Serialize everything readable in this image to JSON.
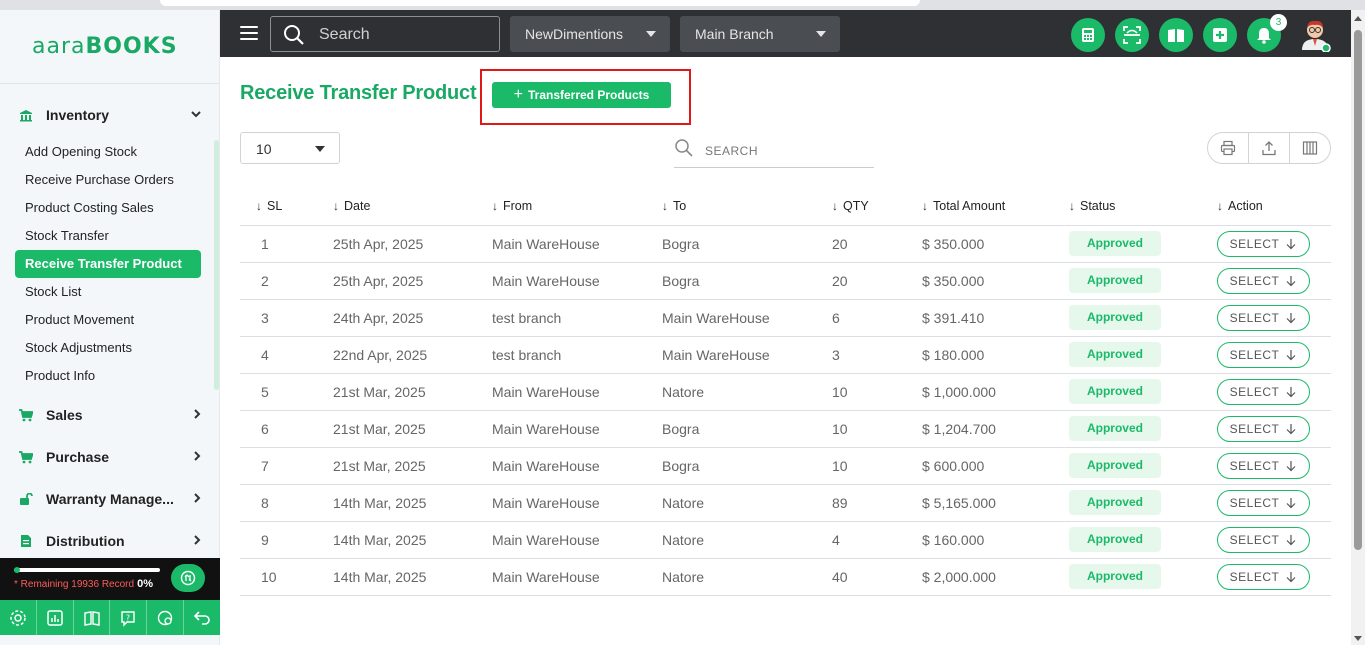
{
  "app": {
    "logo_text_light": "aara",
    "logo_text_bold": "BOOKS",
    "accent_color": "#1aba69"
  },
  "topbar": {
    "search_placeholder": "Search",
    "company_select": "NewDimentions",
    "branch_select": "Main Branch",
    "notification_count": "3",
    "icons": [
      "calculator-icon",
      "scan-icon",
      "book-icon",
      "plus-box-icon",
      "bell-icon"
    ]
  },
  "sidebar": {
    "groups": [
      {
        "label": "Inventory",
        "icon": "warehouse-icon",
        "expanded": true
      },
      {
        "label": "Sales",
        "icon": "cart-icon"
      },
      {
        "label": "Purchase",
        "icon": "cart-icon"
      },
      {
        "label": "Warranty Manage...",
        "icon": "unlock-icon"
      },
      {
        "label": "Distribution",
        "icon": "document-icon"
      }
    ],
    "inventory_items": [
      "Add Opening Stock",
      "Receive Purchase Orders",
      "Product Costing Sales",
      "Stock Transfer",
      "Receive Transfer Product",
      "Stock List",
      "Product Movement",
      "Stock Adjustments",
      "Product Info"
    ],
    "active_item": "Receive Transfer Product",
    "record_text": "* Remaining 19936 Record",
    "record_percent": "0%",
    "bottom_icons": [
      "settings-icon",
      "chart-icon",
      "book-open-icon",
      "help-icon",
      "chat-icon",
      "undo-icon"
    ]
  },
  "main": {
    "title": "Receive Transfer Product",
    "add_button_label": "Transferred Products",
    "page_size": "10",
    "search_placeholder": "SEARCH",
    "table": {
      "headers": [
        "SL",
        "Date",
        "From",
        "To",
        "QTY",
        "Total Amount",
        "Status",
        "Action"
      ],
      "rows": [
        {
          "sl": "1",
          "date": "25th Apr, 2025",
          "from": "Main WareHouse",
          "to": "Bogra",
          "qty": "20",
          "amount": "$ 350.000",
          "status": "Approved",
          "action": "SELECT"
        },
        {
          "sl": "2",
          "date": "25th Apr, 2025",
          "from": "Main WareHouse",
          "to": "Bogra",
          "qty": "20",
          "amount": "$ 350.000",
          "status": "Approved",
          "action": "SELECT"
        },
        {
          "sl": "3",
          "date": "24th Apr, 2025",
          "from": "test branch",
          "to": "Main WareHouse",
          "qty": "6",
          "amount": "$ 391.410",
          "status": "Approved",
          "action": "SELECT"
        },
        {
          "sl": "4",
          "date": "22nd Apr, 2025",
          "from": "test branch",
          "to": "Main WareHouse",
          "qty": "3",
          "amount": "$ 180.000",
          "status": "Approved",
          "action": "SELECT"
        },
        {
          "sl": "5",
          "date": "21st Mar, 2025",
          "from": "Main WareHouse",
          "to": "Natore",
          "qty": "10",
          "amount": "$ 1,000.000",
          "status": "Approved",
          "action": "SELECT"
        },
        {
          "sl": "6",
          "date": "21st Mar, 2025",
          "from": "Main WareHouse",
          "to": "Bogra",
          "qty": "10",
          "amount": "$ 1,204.700",
          "status": "Approved",
          "action": "SELECT"
        },
        {
          "sl": "7",
          "date": "21st Mar, 2025",
          "from": "Main WareHouse",
          "to": "Bogra",
          "qty": "10",
          "amount": "$ 600.000",
          "status": "Approved",
          "action": "SELECT"
        },
        {
          "sl": "8",
          "date": "14th Mar, 2025",
          "from": "Main WareHouse",
          "to": "Natore",
          "qty": "89",
          "amount": "$ 5,165.000",
          "status": "Approved",
          "action": "SELECT"
        },
        {
          "sl": "9",
          "date": "14th Mar, 2025",
          "from": "Main WareHouse",
          "to": "Natore",
          "qty": "4",
          "amount": "$ 160.000",
          "status": "Approved",
          "action": "SELECT"
        },
        {
          "sl": "10",
          "date": "14th Mar, 2025",
          "from": "Main WareHouse",
          "to": "Natore",
          "qty": "40",
          "amount": "$ 2,000.000",
          "status": "Approved",
          "action": "SELECT"
        }
      ]
    }
  }
}
